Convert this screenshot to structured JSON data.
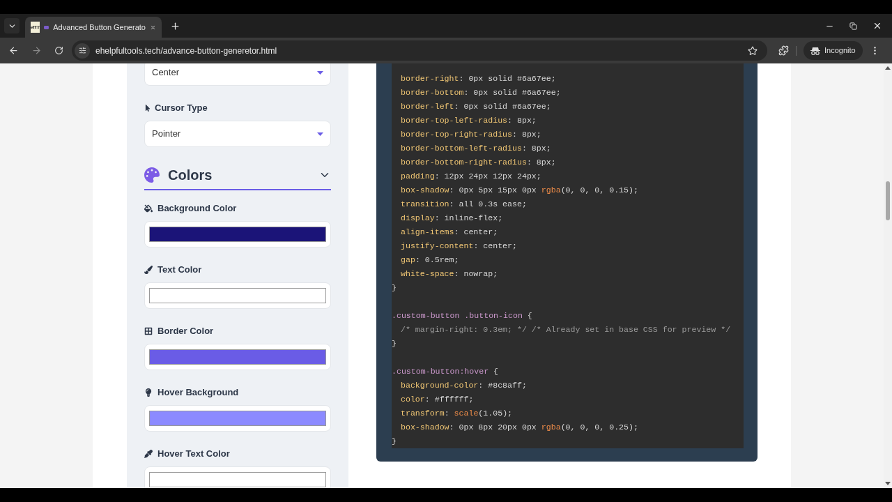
{
  "browser": {
    "tab": {
      "favicon_text": "eHT",
      "title": "Advanced Button Generato"
    },
    "url": "ehelpfultools.tech/advance-button-generetor.html",
    "profile_label": "Incognito"
  },
  "settings_panel": {
    "alignment_select": {
      "value": "Center"
    },
    "cursor_type": {
      "label": "Cursor Type",
      "value": "Pointer"
    },
    "colors_section": {
      "title": "Colors",
      "expanded": true,
      "fields": [
        {
          "label": "Background Color",
          "color": "#1b1478"
        },
        {
          "label": "Text Color",
          "color": "#ffffff"
        },
        {
          "label": "Border Color",
          "color": "#6a5ce6"
        },
        {
          "label": "Hover Background",
          "color": "#8c8aff"
        },
        {
          "label": "Hover Text Color",
          "color": "#ffffff"
        }
      ]
    }
  },
  "code_panel": {
    "lines": [
      {
        "kind": "code",
        "indented": true,
        "tokens": [
          {
            "kind": "prop",
            "text": "border-right"
          },
          {
            "kind": "plain",
            "text": ": 0px solid #6a67ee;"
          }
        ]
      },
      {
        "kind": "code",
        "indented": true,
        "tokens": [
          {
            "kind": "prop",
            "text": "border-bottom"
          },
          {
            "kind": "plain",
            "text": ": 0px solid #6a67ee;"
          }
        ]
      },
      {
        "kind": "code",
        "indented": true,
        "tokens": [
          {
            "kind": "prop",
            "text": "border-left"
          },
          {
            "kind": "plain",
            "text": ": 0px solid #6a67ee;"
          }
        ]
      },
      {
        "kind": "code",
        "indented": true,
        "tokens": [
          {
            "kind": "prop",
            "text": "border-top-left-radius"
          },
          {
            "kind": "plain",
            "text": ": 8px;"
          }
        ]
      },
      {
        "kind": "code",
        "indented": true,
        "tokens": [
          {
            "kind": "prop",
            "text": "border-top-right-radius"
          },
          {
            "kind": "plain",
            "text": ": 8px;"
          }
        ]
      },
      {
        "kind": "code",
        "indented": true,
        "tokens": [
          {
            "kind": "prop",
            "text": "border-bottom-left-radius"
          },
          {
            "kind": "plain",
            "text": ": 8px;"
          }
        ]
      },
      {
        "kind": "code",
        "indented": true,
        "tokens": [
          {
            "kind": "prop",
            "text": "border-bottom-right-radius"
          },
          {
            "kind": "plain",
            "text": ": 8px;"
          }
        ]
      },
      {
        "kind": "code",
        "indented": true,
        "tokens": [
          {
            "kind": "prop",
            "text": "padding"
          },
          {
            "kind": "plain",
            "text": ": 12px 24px 12px 24px;"
          }
        ]
      },
      {
        "kind": "code",
        "indented": true,
        "tokens": [
          {
            "kind": "prop",
            "text": "box-shadow"
          },
          {
            "kind": "plain",
            "text": ": 0px 5px 15px 0px "
          },
          {
            "kind": "fn",
            "text": "rgba"
          },
          {
            "kind": "plain",
            "text": "(0, 0, 0, 0.15);"
          }
        ]
      },
      {
        "kind": "code",
        "indented": true,
        "tokens": [
          {
            "kind": "prop",
            "text": "transition"
          },
          {
            "kind": "plain",
            "text": ": all 0.3s ease;"
          }
        ]
      },
      {
        "kind": "code",
        "indented": true,
        "tokens": [
          {
            "kind": "prop",
            "text": "display"
          },
          {
            "kind": "plain",
            "text": ": inline-flex;"
          }
        ]
      },
      {
        "kind": "code",
        "indented": true,
        "tokens": [
          {
            "kind": "prop",
            "text": "align-items"
          },
          {
            "kind": "plain",
            "text": ": center;"
          }
        ]
      },
      {
        "kind": "code",
        "indented": true,
        "tokens": [
          {
            "kind": "prop",
            "text": "justify-content"
          },
          {
            "kind": "plain",
            "text": ": center;"
          }
        ]
      },
      {
        "kind": "code",
        "indented": true,
        "tokens": [
          {
            "kind": "prop",
            "text": "gap"
          },
          {
            "kind": "plain",
            "text": ": 0.5rem;"
          }
        ]
      },
      {
        "kind": "code",
        "indented": true,
        "tokens": [
          {
            "kind": "prop",
            "text": "white-space"
          },
          {
            "kind": "plain",
            "text": ": nowrap;"
          }
        ]
      },
      {
        "kind": "code",
        "indented": false,
        "tokens": [
          {
            "kind": "plain",
            "text": "}"
          }
        ]
      },
      {
        "kind": "blank"
      },
      {
        "kind": "code",
        "indented": false,
        "tokens": [
          {
            "kind": "sel",
            "text": ".custom-button .button-icon"
          },
          {
            "kind": "plain",
            "text": " {"
          }
        ]
      },
      {
        "kind": "code",
        "indented": true,
        "tokens": [
          {
            "kind": "comment",
            "text": "/* margin-right: 0.3em; */ /* Already set in base CSS for preview */"
          }
        ]
      },
      {
        "kind": "code",
        "indented": false,
        "tokens": [
          {
            "kind": "plain",
            "text": "}"
          }
        ]
      },
      {
        "kind": "blank"
      },
      {
        "kind": "code",
        "indented": false,
        "tokens": [
          {
            "kind": "sel",
            "text": ".custom-button:hover"
          },
          {
            "kind": "plain",
            "text": " {"
          }
        ]
      },
      {
        "kind": "code",
        "indented": true,
        "tokens": [
          {
            "kind": "prop",
            "text": "background-color"
          },
          {
            "kind": "plain",
            "text": ": #8c8aff;"
          }
        ]
      },
      {
        "kind": "code",
        "indented": true,
        "tokens": [
          {
            "kind": "prop",
            "text": "color"
          },
          {
            "kind": "plain",
            "text": ": #ffffff;"
          }
        ]
      },
      {
        "kind": "code",
        "indented": true,
        "tokens": [
          {
            "kind": "prop",
            "text": "transform"
          },
          {
            "kind": "plain",
            "text": ": "
          },
          {
            "kind": "fn",
            "text": "scale"
          },
          {
            "kind": "plain",
            "text": "(1.05);"
          }
        ]
      },
      {
        "kind": "code",
        "indented": true,
        "tokens": [
          {
            "kind": "prop",
            "text": "box-shadow"
          },
          {
            "kind": "plain",
            "text": ": 0px 8px 20px 0px "
          },
          {
            "kind": "fn",
            "text": "rgba"
          },
          {
            "kind": "plain",
            "text": "(0, 0, 0, 0.25);"
          }
        ]
      },
      {
        "kind": "code",
        "indented": false,
        "tokens": [
          {
            "kind": "plain",
            "text": "}"
          }
        ]
      }
    ]
  }
}
